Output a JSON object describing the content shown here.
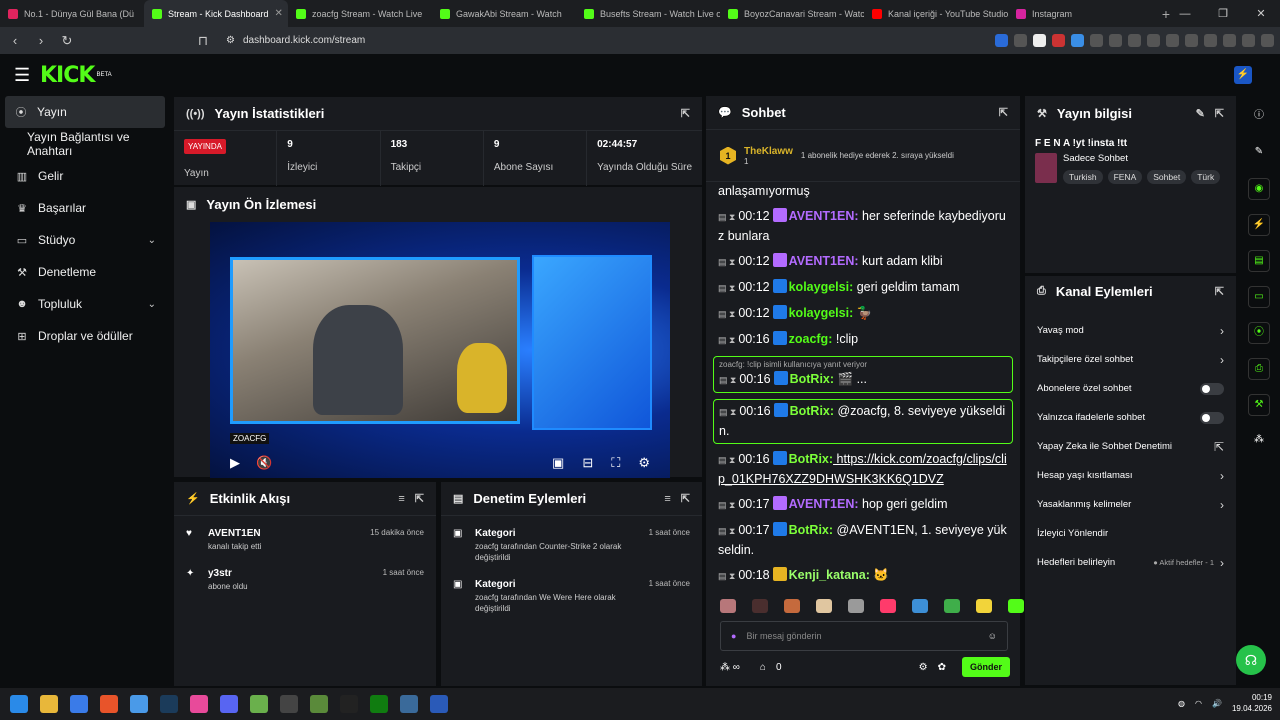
{
  "browser": {
    "tabs": [
      {
        "label": "No.1 - Dünya Gül Bana (Dü",
        "color": "#e0245e"
      },
      {
        "label": "Stream - Kick Dashboard",
        "color": "#53fc18"
      },
      {
        "label": "zoacfg Stream - Watch Live",
        "color": "#53fc18"
      },
      {
        "label": "GawakAbi Stream - Watch",
        "color": "#53fc18"
      },
      {
        "label": "Busefts Stream - Watch Live or",
        "color": "#53fc18"
      },
      {
        "label": "BoyozCanavari Stream - Watch",
        "color": "#53fc18"
      },
      {
        "label": "Kanal içeriği - YouTube Studio",
        "color": "#ff0000"
      },
      {
        "label": "Instagram",
        "color": "#d6249f"
      }
    ],
    "url": "dashboard.kick.com/stream"
  },
  "header": {
    "logo": "KICK",
    "beta": "BETA"
  },
  "sidebar": {
    "items": [
      {
        "label": "Yayın",
        "icon": "broadcast-icon"
      },
      {
        "label": "Yayın Bağlantısı ve Anahtarı"
      },
      {
        "label": "Gelir",
        "icon": "chart-icon"
      },
      {
        "label": "Başarılar",
        "icon": "trophy-icon"
      },
      {
        "label": "Stüdyo",
        "icon": "studio-icon"
      },
      {
        "label": "Denetleme",
        "icon": "wrench-icon"
      },
      {
        "label": "Topluluk",
        "icon": "users-icon"
      },
      {
        "label": "Droplar ve ödüller",
        "icon": "gift-icon"
      }
    ]
  },
  "stats": {
    "title": "Yayın İstatistikleri",
    "live": "YAYINDA",
    "stream_label": "Yayın",
    "items": [
      {
        "value": "9",
        "label": "İzleyici"
      },
      {
        "value": "183",
        "label": "Takipçi"
      },
      {
        "value": "9",
        "label": "Abone Sayısı"
      },
      {
        "value": "02:44:57",
        "label": "Yayında Olduğu Süre"
      }
    ]
  },
  "preview": {
    "title": "Yayın Ön İzlemesi",
    "handle": "ZOACFG"
  },
  "activity": {
    "title": "Etkinlik Akışı",
    "items": [
      {
        "user": "AVENT1EN",
        "desc": "kanalı takip etti",
        "time": "15 dakika önce"
      },
      {
        "user": "y3str",
        "desc": "abone oldu",
        "time": "1 saat önce"
      }
    ]
  },
  "moderation": {
    "title": "Denetim Eylemleri",
    "items": [
      {
        "title": "Kategori",
        "user": "zoacfg",
        "mid": " tarafından ",
        "cat": "Counter-Strike 2",
        "end": " olarak değiştirildi",
        "time": "1 saat önce"
      },
      {
        "title": "Kategori",
        "user": "zoacfg",
        "mid": " tarafından ",
        "cat": "We Were Here",
        "end": " olarak değiştirildi",
        "time": "1 saat önce"
      }
    ]
  },
  "chat": {
    "title": "Sohbet",
    "pinned": {
      "user": "TheKlaww",
      "level": "1",
      "rank": "1",
      "info": "1 abonelik hediye ederek 2. sıraya yükseldi"
    },
    "first_line": "anlaşamıyormuş",
    "messages": [
      {
        "time": "00:12",
        "user": "AVENT1EN",
        "cls": "u-purple",
        "text": " her seferinde kaybediyoruz bunlara"
      },
      {
        "time": "00:12",
        "user": "AVENT1EN",
        "cls": "u-purple",
        "text": " kurt adam klibi"
      },
      {
        "time": "00:12",
        "user": "kolaygelsi",
        "cls": "u-green",
        "text": " geri geldim tamam"
      },
      {
        "time": "00:12",
        "user": "kolaygelsi",
        "cls": "u-green",
        "text": " 🦆"
      },
      {
        "time": "00:16",
        "user": "zoacfg",
        "cls": "u-green",
        "text": " !clip"
      },
      {
        "time": "00:16",
        "user": "BotRix",
        "cls": "u-lime",
        "text": " 🎬 ...",
        "reply": "zoacfg: !clip isimli kullanıcıya yanıt veriyor",
        "hl": true
      },
      {
        "time": "00:16",
        "user": "BotRix",
        "cls": "u-lime",
        "text": " @zoacfg, 8. seviyeye yükseldin.",
        "hl": true
      },
      {
        "time": "00:16",
        "user": "BotRix",
        "cls": "u-lime",
        "text": " https://kick.com/zoacfg/clips/clip_01KPH76XZZ9DHWSHK3KK6Q1DVZ",
        "link": true
      },
      {
        "time": "00:17",
        "user": "AVENT1EN",
        "cls": "u-purple",
        "text": " hop geri geldim"
      },
      {
        "time": "00:17",
        "user": "BotRix",
        "cls": "u-lime",
        "text": " @AVENT1EN, 1. seviyeye yükseldin."
      },
      {
        "time": "00:18",
        "user": "Kenji_katana",
        "cls": "u-gold",
        "text": " 🐱"
      }
    ],
    "placeholder": "Bir mesaj gönderin",
    "count": "0",
    "send": "Gönder"
  },
  "info": {
    "title": "Yayın bilgisi",
    "stream_title": "F E N A !yt !insta !tt",
    "category": "Sadece Sohbet",
    "tags": [
      "Turkish",
      "FENA",
      "Sohbet",
      "Türk"
    ]
  },
  "actions": {
    "title": "Kanal Eylemleri",
    "items": [
      {
        "label": "Yavaş mod",
        "ctl": "›"
      },
      {
        "label": "Takipçilere özel sohbet",
        "ctl": "›"
      },
      {
        "label": "Abonelere özel sohbet",
        "ctl": "toggle"
      },
      {
        "label": "Yalnızca ifadelerle sohbet",
        "ctl": "toggle"
      },
      {
        "label": "Yapay Zeka ile Sohbet Denetimi",
        "ctl": "⇱"
      },
      {
        "label": "Hesap yaşı kısıtlaması",
        "ctl": "›"
      },
      {
        "label": "Yasaklanmış kelimeler",
        "ctl": "›"
      },
      {
        "label": "İzleyici Yönlendir",
        "ctl": ""
      },
      {
        "label": "Hedefleri belirleyin",
        "ctl": "›",
        "extra": "● Aktif hedefler - 1"
      }
    ]
  },
  "taskbar": {
    "time": "00:19",
    "date": "19.04.2026"
  }
}
